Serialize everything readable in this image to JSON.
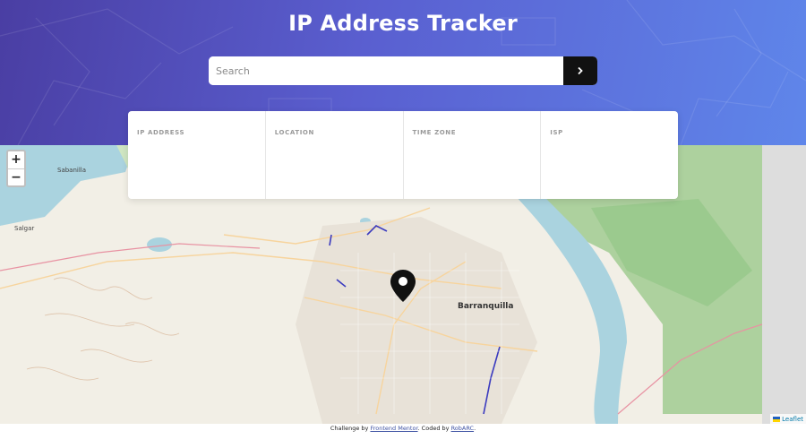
{
  "header": {
    "title": "IP Address Tracker",
    "gradient": [
      "#4a3ea3",
      "#5f86ea"
    ]
  },
  "search": {
    "placeholder": "Search",
    "value": "",
    "button_icon": "chevron-right-icon"
  },
  "info": {
    "ip_label": "IP ADDRESS",
    "ip_value": "",
    "location_label": "LOCATION",
    "location_value": "",
    "timezone_label": "TIME ZONE",
    "timezone_value": "",
    "isp_label": "ISP",
    "isp_value": ""
  },
  "map": {
    "zoom_in": "+",
    "zoom_out": "−",
    "city_label": "Barranquilla",
    "place_labels": [
      "Sabanilla",
      "Salgar"
    ],
    "marker_icon": "location-pin-icon",
    "attribution": "Leaflet"
  },
  "footer": {
    "prefix": "Challenge by ",
    "link1": "Frontend Mentor",
    "middle": ". Coded by ",
    "link2": "RobARC",
    "suffix": "."
  }
}
